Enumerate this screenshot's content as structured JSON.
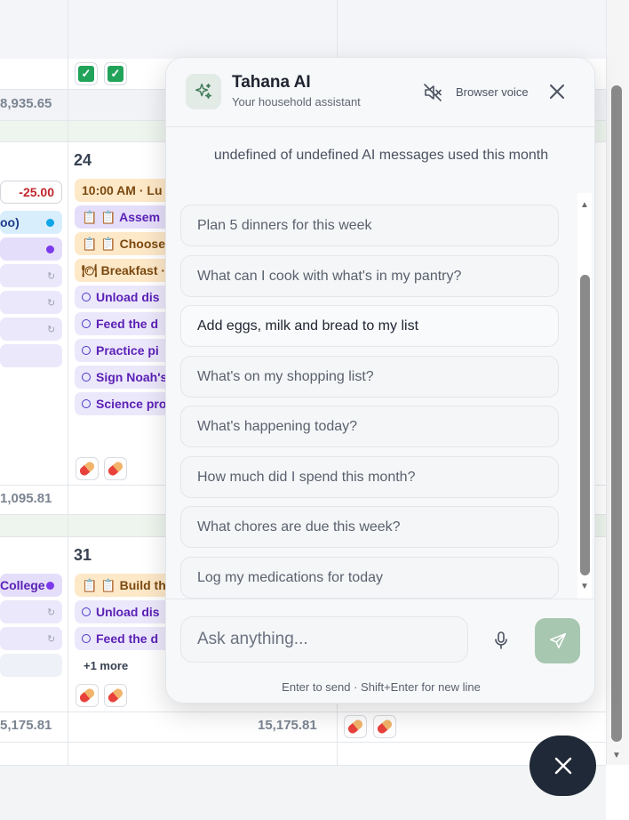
{
  "calendar": {
    "amounts": {
      "top_left": "8,935.65",
      "mid_left": "1,095.81",
      "bottom_left": "5,175.81",
      "bottom_mid": "15,175.81"
    },
    "days": {
      "day_a": "24",
      "day_b": "31"
    },
    "left_col": {
      "neg_amount": "-25.00",
      "chip_1": "oo)",
      "chip_college": "College"
    },
    "mid_col_week1": [
      {
        "text": "10:00 AM · Lu",
        "style": "orange"
      },
      {
        "text": "📋 📋 Assem",
        "style": "purple"
      },
      {
        "text": "📋 📋 Choose",
        "style": "orange"
      },
      {
        "text": "🍽 Breakfast ·",
        "style": "orange"
      },
      {
        "text": "Unload dis",
        "style": "lav",
        "circle": true
      },
      {
        "text": "Feed the d",
        "style": "lav",
        "circle": true
      },
      {
        "text": "Practice pi",
        "style": "lav",
        "circle": true
      },
      {
        "text": "Sign Noah's",
        "style": "lav",
        "circle": true
      },
      {
        "text": "Science pro",
        "style": "lav",
        "circle": true
      }
    ],
    "mid_col_week2": [
      {
        "text": "📋 📋 Build th",
        "style": "orange"
      },
      {
        "text": "Unload dis",
        "style": "lav",
        "circle": true
      },
      {
        "text": "Feed the d",
        "style": "lav",
        "circle": true
      }
    ],
    "more_label": "+1 more"
  },
  "chat": {
    "title": "Tahana AI",
    "subtitle": "Your household assistant",
    "voice_label": "Browser voice",
    "usage_text": "undefined of undefined AI messages used this month",
    "suggestions": [
      "Plan 5 dinners for this week",
      "What can I cook with what's in my pantry?",
      "Add eggs, milk and bread to my list",
      "What's on my shopping list?",
      "What's happening today?",
      "How much did I spend this month?",
      "What chores are due this week?",
      "Log my medications for today"
    ],
    "input_placeholder": "Ask anything...",
    "hint": "Enter to send · Shift+Enter for new line"
  },
  "icons": {
    "logo": "sparkles-icon",
    "voice": "speaker-muted-icon",
    "close": "close-icon",
    "mic": "microphone-icon",
    "send": "send-icon",
    "fab": "close-icon"
  },
  "colors": {
    "accent": "#a8c7b1",
    "fab": "#1f2937"
  }
}
